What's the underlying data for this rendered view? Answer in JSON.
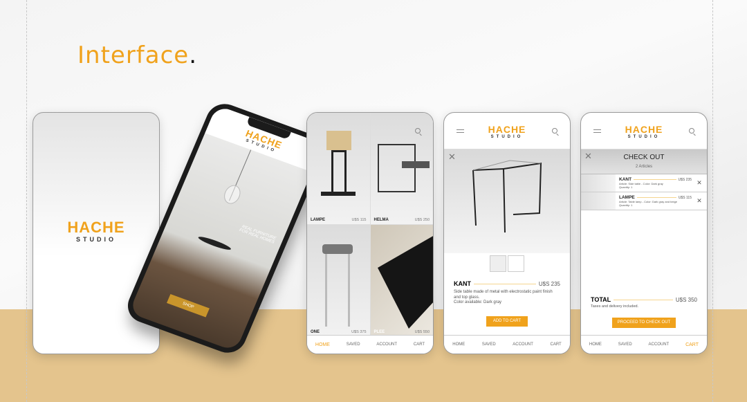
{
  "heading": {
    "title": "Interface",
    "dot": "."
  },
  "brand": {
    "name": "HACHE",
    "sub": "STUDIO",
    "accent": "#f0a21c",
    "tan": "#e4c48d"
  },
  "phone": {
    "tagline1": "REAL FURNITURE",
    "tagline2": "FOR REAL HOMES",
    "shop": "SHOP"
  },
  "nav": [
    "HOME",
    "SAVED",
    "ACCOUNT",
    "CART"
  ],
  "catalog": {
    "active_tab": "HOME",
    "products": [
      {
        "name": "LAMPE",
        "price": "U$S 115"
      },
      {
        "name": "HELMA",
        "price": "U$S 250"
      },
      {
        "name": "ONE",
        "price": "U$S 375"
      },
      {
        "name": "PLEE",
        "price": "U$S 550"
      }
    ]
  },
  "detail": {
    "name": "KANT",
    "price": "U$S 235",
    "desc": "Side table made of metal with electrostatic paint finish and top glass.",
    "color": "Color available:  Dark gray",
    "button": "ADD TO CART"
  },
  "checkout": {
    "title": "CHECK OUT",
    "count": "2 Articles",
    "active_tab": "CART",
    "items": [
      {
        "name": "KANT",
        "price": "U$S 235",
        "desc": "Article: Side table - Color: Dark gray",
        "qty": "Quantity: 1"
      },
      {
        "name": "LAMPE",
        "price": "U$S 115",
        "desc": "Article: Table lamp - Color: Dark gray and beige",
        "qty": "Quantity: 1"
      }
    ],
    "total_label": "TOTAL",
    "total": "U$S 350",
    "note": "Taxes and delivery included.",
    "button": "PROCEED TO CHECK OUT"
  }
}
